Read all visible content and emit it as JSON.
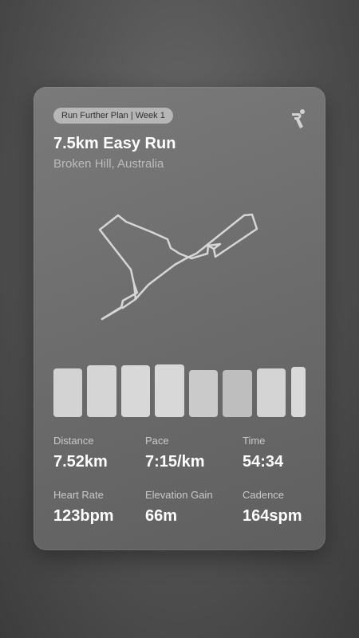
{
  "card": {
    "plan_badge": "Run Further Plan | Week 1",
    "title": "7.5km Easy Run",
    "location": "Broken Hill, Australia",
    "logo_icon": "runner-logo-icon"
  },
  "splits": {
    "levels": [
      0.94,
      1.0,
      1.0,
      1.02,
      0.91,
      0.91,
      0.95,
      0.98
    ],
    "colors": [
      "#d3d3d3",
      "#d5d5d5",
      "#d8d8d8",
      "#d8d8d8",
      "#cacaca",
      "#bebebe",
      "#d4d4d4",
      "#d9d9d9"
    ]
  },
  "stats": [
    {
      "label": "Distance",
      "value": "7.52km"
    },
    {
      "label": "Pace",
      "value": "7:15/km"
    },
    {
      "label": "Time",
      "value": "54:34"
    },
    {
      "label": "Heart Rate",
      "value": "123bpm"
    },
    {
      "label": "Elevation Gain",
      "value": "66m"
    },
    {
      "label": "Cadence",
      "value": "164spm"
    }
  ],
  "colors": {
    "route_stroke": "#d6d6d6",
    "text_primary": "#ffffff",
    "text_secondary": "#bcbcbc"
  }
}
